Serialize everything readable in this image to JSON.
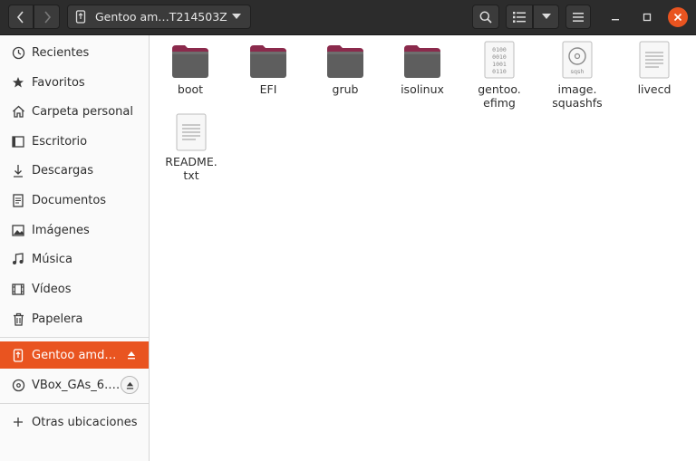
{
  "header": {
    "path_label": "Gentoo am…T214503Z",
    "colors": {
      "bar": "#2c2c2c",
      "close": "#e95420"
    }
  },
  "sidebar": {
    "items": [
      {
        "label": "Recientes",
        "icon": "clock-icon"
      },
      {
        "label": "Favoritos",
        "icon": "star-icon"
      },
      {
        "label": "Carpeta personal",
        "icon": "home-icon"
      },
      {
        "label": "Escritorio",
        "icon": "desktop-icon"
      },
      {
        "label": "Descargas",
        "icon": "download-icon"
      },
      {
        "label": "Documentos",
        "icon": "document-icon"
      },
      {
        "label": "Imágenes",
        "icon": "image-icon"
      },
      {
        "label": "Música",
        "icon": "music-icon"
      },
      {
        "label": "Vídeos",
        "icon": "video-icon"
      },
      {
        "label": "Papelera",
        "icon": "trash-icon"
      }
    ],
    "devices": [
      {
        "label": "Gentoo amd…",
        "icon": "usb-drive-icon",
        "active": true
      },
      {
        "label": "VBox_GAs_6.…",
        "icon": "optical-disc-icon",
        "active": false
      }
    ],
    "other_locations": "Otras ubicaciones",
    "accent": "#e95420"
  },
  "files": [
    {
      "name": "boot",
      "type": "folder"
    },
    {
      "name": "EFI",
      "type": "folder"
    },
    {
      "name": "grub",
      "type": "folder"
    },
    {
      "name": "isolinux",
      "type": "folder"
    },
    {
      "name": "gentoo.\nefimg",
      "type": "binary"
    },
    {
      "name": "image.\nsquashfs",
      "type": "disc-image",
      "icon_text": "sqsh"
    },
    {
      "name": "livecd",
      "type": "text"
    },
    {
      "name": "README.\ntxt",
      "type": "text"
    }
  ],
  "binary_icon_rows": [
    "0100",
    "0010",
    "1001",
    "0110"
  ]
}
